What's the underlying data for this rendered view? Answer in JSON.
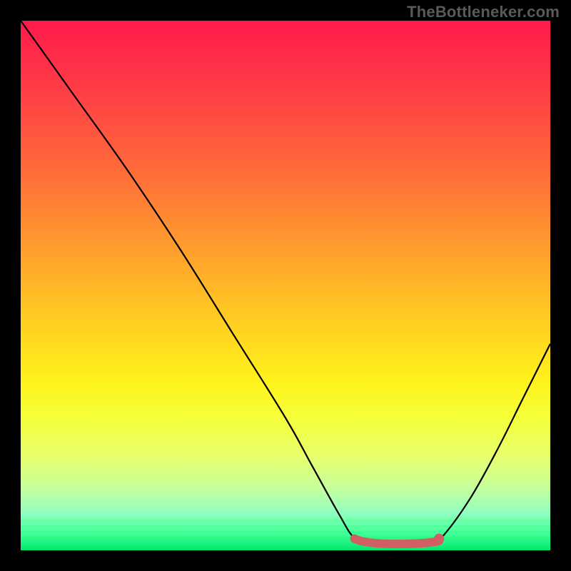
{
  "watermark": "TheBottleneker.com",
  "colors": {
    "frame": "#000000",
    "curve": "#000000",
    "trough_marker": "#cf5f62",
    "gradient_top": "#ff1a4b",
    "gradient_bottom": "#00e86a"
  },
  "chart_data": {
    "type": "line",
    "title": "",
    "xlabel": "",
    "ylabel": "",
    "xlim": [
      0,
      100
    ],
    "ylim": [
      0,
      100
    ],
    "grid": false,
    "legend": false,
    "curve_y_of_x": [
      {
        "x": 0,
        "y": 100
      },
      {
        "x": 5,
        "y": 93
      },
      {
        "x": 10,
        "y": 86
      },
      {
        "x": 20,
        "y": 72
      },
      {
        "x": 30,
        "y": 57
      },
      {
        "x": 40,
        "y": 41
      },
      {
        "x": 50,
        "y": 25
      },
      {
        "x": 55,
        "y": 16
      },
      {
        "x": 60,
        "y": 7
      },
      {
        "x": 63,
        "y": 2.3
      },
      {
        "x": 66,
        "y": 1.3
      },
      {
        "x": 70,
        "y": 1.1
      },
      {
        "x": 74,
        "y": 1.1
      },
      {
        "x": 78,
        "y": 1.8
      },
      {
        "x": 80,
        "y": 3
      },
      {
        "x": 85,
        "y": 10
      },
      {
        "x": 90,
        "y": 19
      },
      {
        "x": 95,
        "y": 29
      },
      {
        "x": 100,
        "y": 39
      }
    ],
    "trough_range_x": [
      63,
      79
    ],
    "trough_y": 1.2,
    "trough_end_dot": {
      "x": 79,
      "y": 2.2
    }
  }
}
